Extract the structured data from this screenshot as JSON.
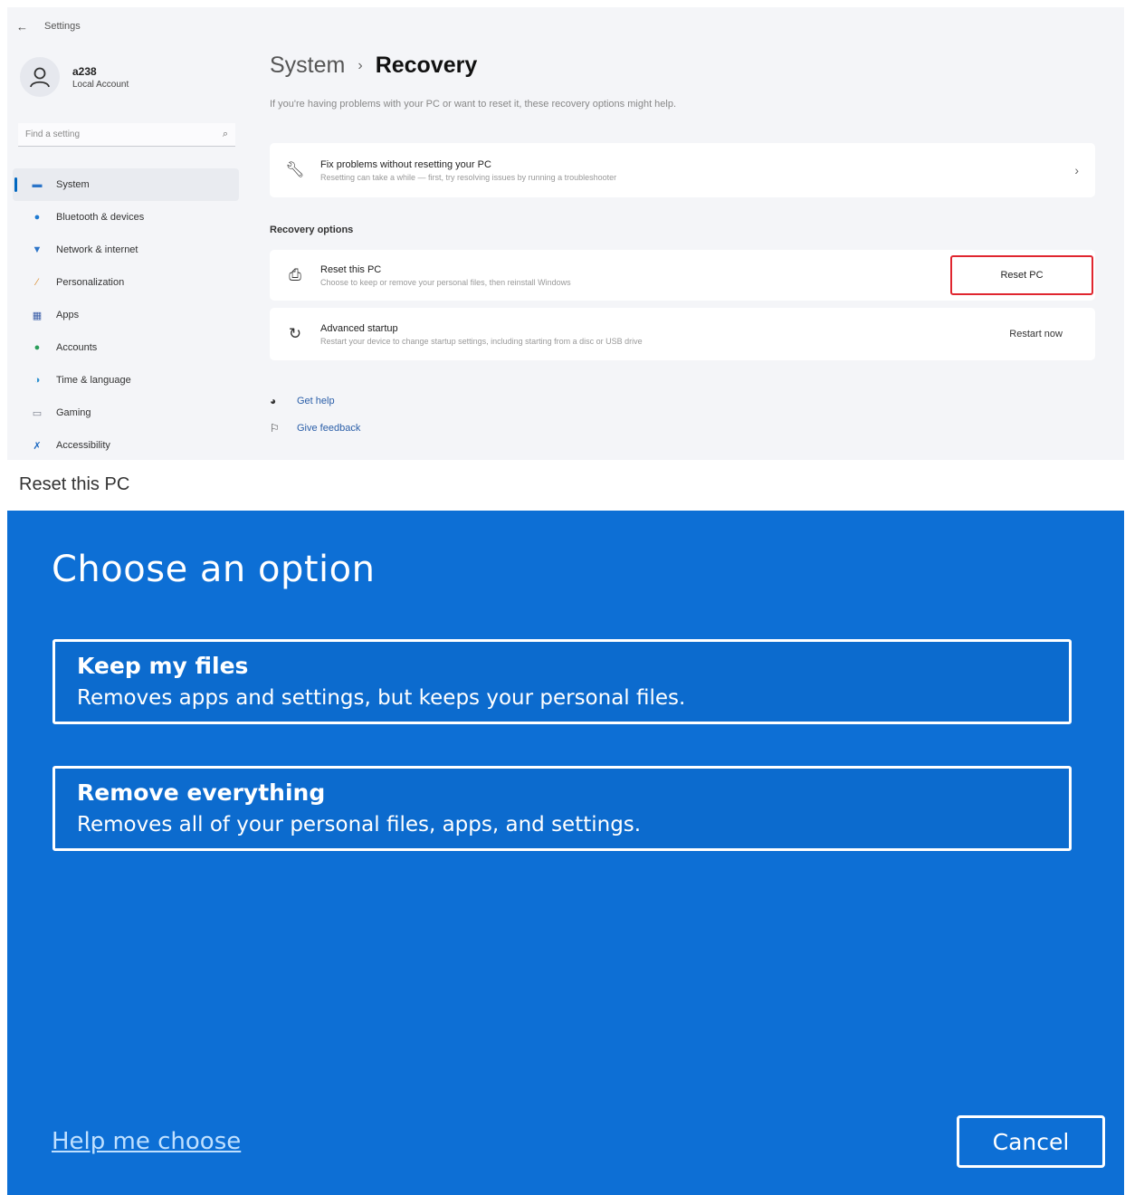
{
  "settings": {
    "title": "Settings",
    "profile": {
      "name": "a238",
      "account_type": "Local Account"
    },
    "search": {
      "placeholder": "Find a setting"
    },
    "nav": [
      {
        "label": "System",
        "icon": "monitor-icon",
        "glyph": "▬",
        "color": "#2b74c8",
        "selected": true
      },
      {
        "label": "Bluetooth & devices",
        "icon": "bluetooth-icon",
        "glyph": "●",
        "color": "#1e7ad1"
      },
      {
        "label": "Network & internet",
        "icon": "wifi-icon",
        "glyph": "▼",
        "color": "#2b74c8"
      },
      {
        "label": "Personalization",
        "icon": "brush-icon",
        "glyph": "⁄",
        "color": "#d98a2b"
      },
      {
        "label": "Apps",
        "icon": "apps-icon",
        "glyph": "▦",
        "color": "#3a5ea8"
      },
      {
        "label": "Accounts",
        "icon": "person-icon",
        "glyph": "●",
        "color": "#2a9d5a"
      },
      {
        "label": "Time & language",
        "icon": "globe-icon",
        "glyph": "◑",
        "color": "#2b8fcf"
      },
      {
        "label": "Gaming",
        "icon": "gamepad-icon",
        "glyph": "▭",
        "color": "#7a7f8c"
      },
      {
        "label": "Accessibility",
        "icon": "accessibility-icon",
        "glyph": "✗",
        "color": "#1f6bc2"
      }
    ],
    "breadcrumb": {
      "parent": "System",
      "separator": "›",
      "current": "Recovery"
    },
    "subtitle": "If you're having problems with your PC or want to reset it, these recovery options might help.",
    "fix_card": {
      "title": "Fix problems without resetting your PC",
      "desc": "Resetting can take a while — first, try resolving issues by running a troubleshooter"
    },
    "section_label": "Recovery options",
    "reset_card": {
      "title": "Reset this PC",
      "desc": "Choose to keep or remove your personal files, then reinstall Windows",
      "button": "Reset PC"
    },
    "advanced_card": {
      "title": "Advanced startup",
      "desc": "Restart your device to change startup settings, including starting from a disc or USB drive",
      "button": "Restart now"
    },
    "links": {
      "help": "Get help",
      "feedback": "Give feedback"
    }
  },
  "section_caption": "Reset this PC",
  "dialog": {
    "title": "Choose an option",
    "options": [
      {
        "title": "Keep my files",
        "desc": "Removes apps and settings, but keeps your personal files."
      },
      {
        "title": "Remove everything",
        "desc": "Removes all of your personal files, apps, and settings."
      }
    ],
    "help_link": "Help me choose",
    "cancel": "Cancel"
  },
  "colors": {
    "dialog_bg": "#0d6fd5",
    "highlight_red": "#e0262f",
    "accent": "#0067c0"
  }
}
